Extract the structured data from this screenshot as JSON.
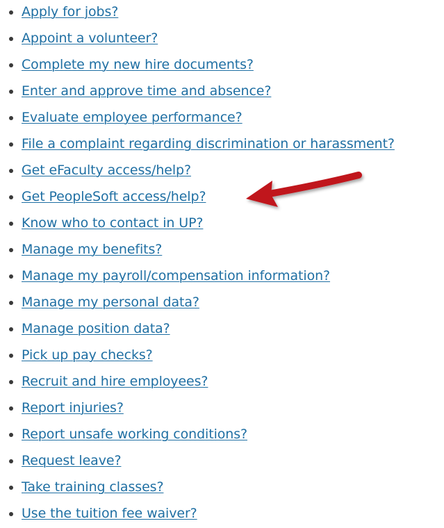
{
  "links": [
    {
      "label": "Apply for jobs?"
    },
    {
      "label": "Appoint a volunteer?"
    },
    {
      "label": "Complete my new hire documents?"
    },
    {
      "label": "Enter and approve time and absence?"
    },
    {
      "label": "Evaluate employee performance?"
    },
    {
      "label": "File a complaint regarding discrimination or harassment?"
    },
    {
      "label": "Get eFaculty access/help?"
    },
    {
      "label": "Get PeopleSoft access/help?"
    },
    {
      "label": "Know who to contact in UP?"
    },
    {
      "label": "Manage my benefits?"
    },
    {
      "label": "Manage my payroll/compensation information?"
    },
    {
      "label": "Manage my personal data?"
    },
    {
      "label": "Manage position data?"
    },
    {
      "label": "Pick up pay checks?"
    },
    {
      "label": "Recruit and hire employees?"
    },
    {
      "label": "Report injuries?"
    },
    {
      "label": "Report unsafe working conditions?"
    },
    {
      "label": "Request leave?"
    },
    {
      "label": "Take training classes?"
    },
    {
      "label": "Use the tuition fee waiver?"
    }
  ],
  "colors": {
    "link": "#1f6fa3",
    "bullet": "#3a3a3a",
    "arrow": "#c0141b"
  },
  "annotation": {
    "icon": "red-arrow-icon",
    "points_to": "Get PeopleSoft access/help?"
  }
}
